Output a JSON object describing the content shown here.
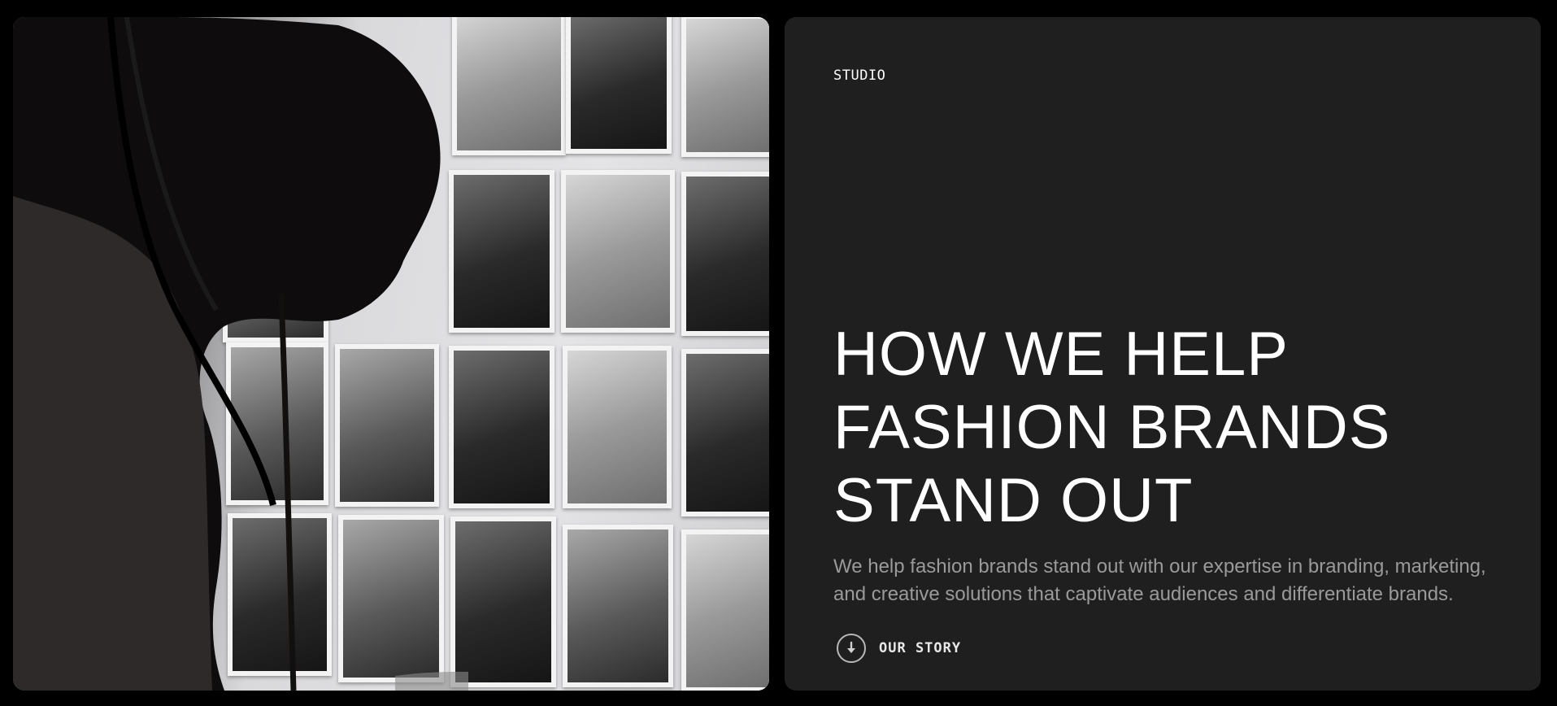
{
  "hero_image": {
    "alt_subject": "person-viewing-fashion-photo-wall"
  },
  "studio_label": "STUDIO",
  "headline": {
    "line1": "HOW WE HELP",
    "line2": "FASHION BRANDS",
    "line3": "STAND OUT"
  },
  "lede": "We help fashion brands stand out with our expertise in branding, marketing, and creative solutions that captivate audiences and differentiate brands.",
  "cta": {
    "label": "OUR STORY",
    "icon": "arrow-down-circle-icon"
  },
  "colors": {
    "page_bg": "#000000",
    "panel_bg": "#1f1f1f",
    "headline": "#ffffff",
    "lede": "#9a9a9a"
  }
}
